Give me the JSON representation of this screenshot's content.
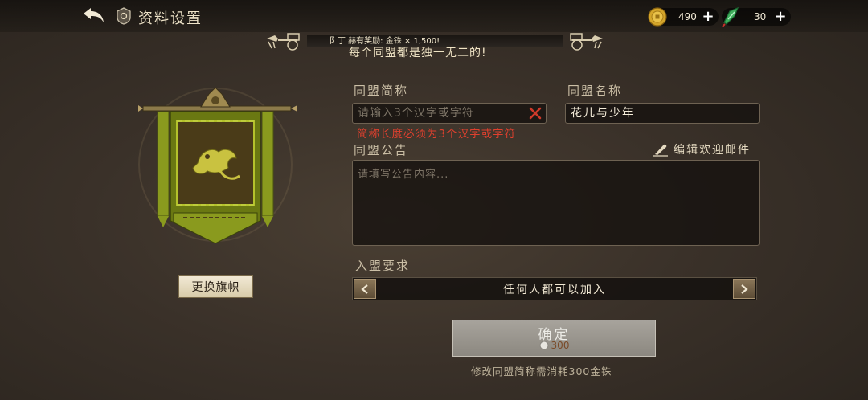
{
  "header": {
    "title": "资料设置",
    "currencies": [
      {
        "icon": "gold-coin-icon",
        "amount": "490"
      },
      {
        "icon": "jade-token-icon",
        "amount": "30"
      }
    ]
  },
  "marquee": {
    "text": "阝丁 赫有奖励: 金铢 × 1,500!"
  },
  "slogan": "每个同盟都是独一无二的!",
  "banner": {
    "change_button": "更换旗帜"
  },
  "form": {
    "short_name": {
      "label": "同盟简称",
      "placeholder": "请输入3个汉字或字符",
      "value": ""
    },
    "error": "简称长度必须为3个汉字或字符",
    "full_name": {
      "label": "同盟名称",
      "value": "花儿与少年"
    },
    "notice": {
      "label": "同盟公告",
      "placeholder": "请填写公告内容..."
    },
    "edit_mail": "编辑欢迎邮件",
    "requirement": {
      "label": "入盟要求",
      "value": "任何人都可以加入"
    },
    "confirm": {
      "label": "确定",
      "cost": "300"
    },
    "cost_note": "修改同盟简称需消耗300金铢"
  },
  "colors": {
    "accent_gold": "#c9a45c",
    "error": "#e0402e",
    "banner_green": "#8a9a1e"
  }
}
